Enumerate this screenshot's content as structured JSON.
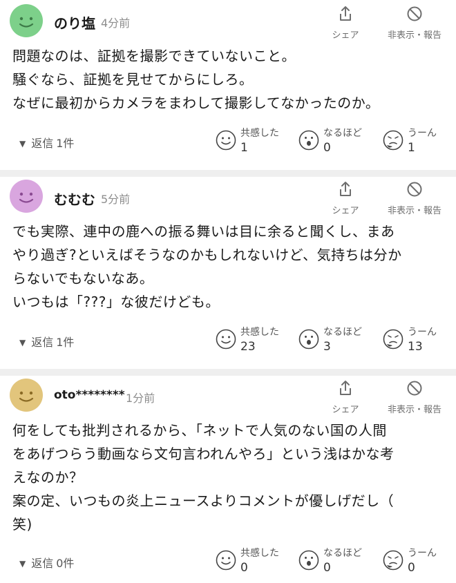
{
  "comments": [
    {
      "username": "のり塩",
      "time": "4分前",
      "avatar_color": "#7dd08a",
      "share_label": "シェア",
      "hide_label": "非表示・報告",
      "body": "問題なのは、証拠を撮影できていないこと。\n騒ぐなら、証拠を見せてからにしろ。\nなぜに最初からカメラをまわして撮影してなかったのか。",
      "reply_label": "返信",
      "reply_count": "1件",
      "reactions": [
        {
          "label": "共感した",
          "count": "1"
        },
        {
          "label": "なるほど",
          "count": "0"
        },
        {
          "label": "うーん",
          "count": "1"
        }
      ]
    },
    {
      "username": "むむむ",
      "time": "5分前",
      "avatar_color": "#d9a6df",
      "share_label": "シェア",
      "hide_label": "非表示・報告",
      "body": "でも実際、連中の鹿への振る舞いは目に余ると聞くし、まあ\nやり過ぎ?といえばそうなのかもしれないけど、気持ちは分か\nらないでもないなあ。\nいつもは「???」な彼だけども。",
      "reply_label": "返信",
      "reply_count": "1件",
      "reactions": [
        {
          "label": "共感した",
          "count": "23"
        },
        {
          "label": "なるほど",
          "count": "3"
        },
        {
          "label": "うーん",
          "count": "13"
        }
      ]
    },
    {
      "username": "oto********",
      "time": "1分前",
      "avatar_color": "#e2c57c",
      "share_label": "シェア",
      "hide_label": "非表示・報告",
      "body": "何をしても批判されるから、「ネットで人気のない国の人間\nをあげつらう動画なら文句言われんやろ」という浅はかな考\nえなのか？\n案の定、いつもの炎上ニュースよりコメントが優しげだし（\n笑)",
      "reply_label": "返信",
      "reply_count": "0件",
      "reactions": [
        {
          "label": "共感した",
          "count": "0"
        },
        {
          "label": "なるほど",
          "count": "0"
        },
        {
          "label": "うーん",
          "count": "0"
        }
      ]
    }
  ],
  "icons": {
    "share": "share-icon",
    "hide": "block-icon",
    "empathy": "smile-face-icon",
    "insight": "surprised-face-icon",
    "hmm": "troubled-face-icon"
  }
}
